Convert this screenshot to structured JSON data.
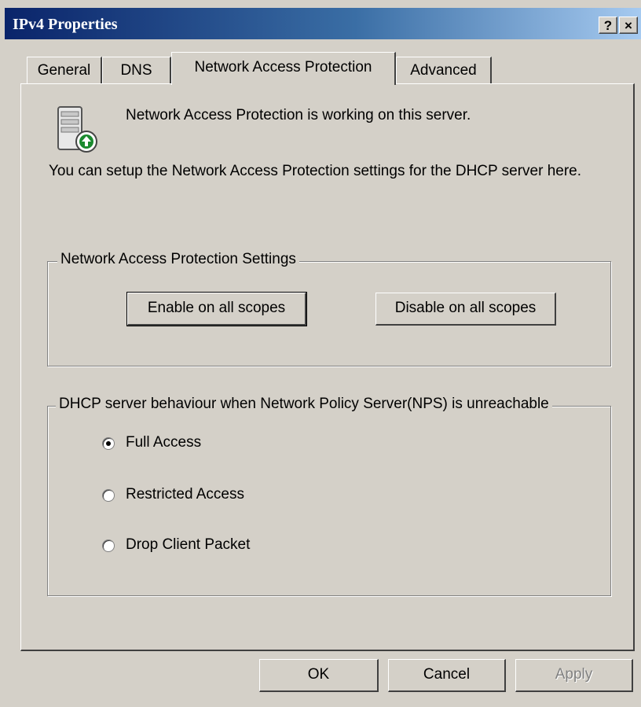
{
  "window": {
    "title": "IPv4 Properties",
    "help_label": "?",
    "close_label": "×"
  },
  "tabs": [
    {
      "label": "General",
      "active": false
    },
    {
      "label": "DNS",
      "active": false
    },
    {
      "label": "Network Access Protection",
      "active": true
    },
    {
      "label": "Advanced",
      "active": false
    }
  ],
  "nap": {
    "status_text": "Network Access Protection is working on this server.",
    "description": "You can setup the Network Access Protection settings for the DHCP server here.",
    "settings_group": {
      "legend": "Network Access Protection Settings",
      "enable_label": "Enable on all scopes",
      "disable_label": "Disable on all scopes"
    },
    "behaviour_group": {
      "legend": "DHCP server behaviour when Network Policy Server(NPS) is unreachable",
      "options": [
        {
          "label": "Full Access",
          "selected": true
        },
        {
          "label": "Restricted Access",
          "selected": false
        },
        {
          "label": "Drop Client Packet",
          "selected": false
        }
      ]
    }
  },
  "footer": {
    "ok_label": "OK",
    "cancel_label": "Cancel",
    "apply_label": "Apply",
    "apply_enabled": false
  },
  "icons": {
    "server": "server-status-icon"
  },
  "colors": {
    "titlebar_start": "#0a246a",
    "titlebar_end": "#a6caf0",
    "face": "#d4d0c8",
    "status_arrow": "#1a8a2e"
  }
}
